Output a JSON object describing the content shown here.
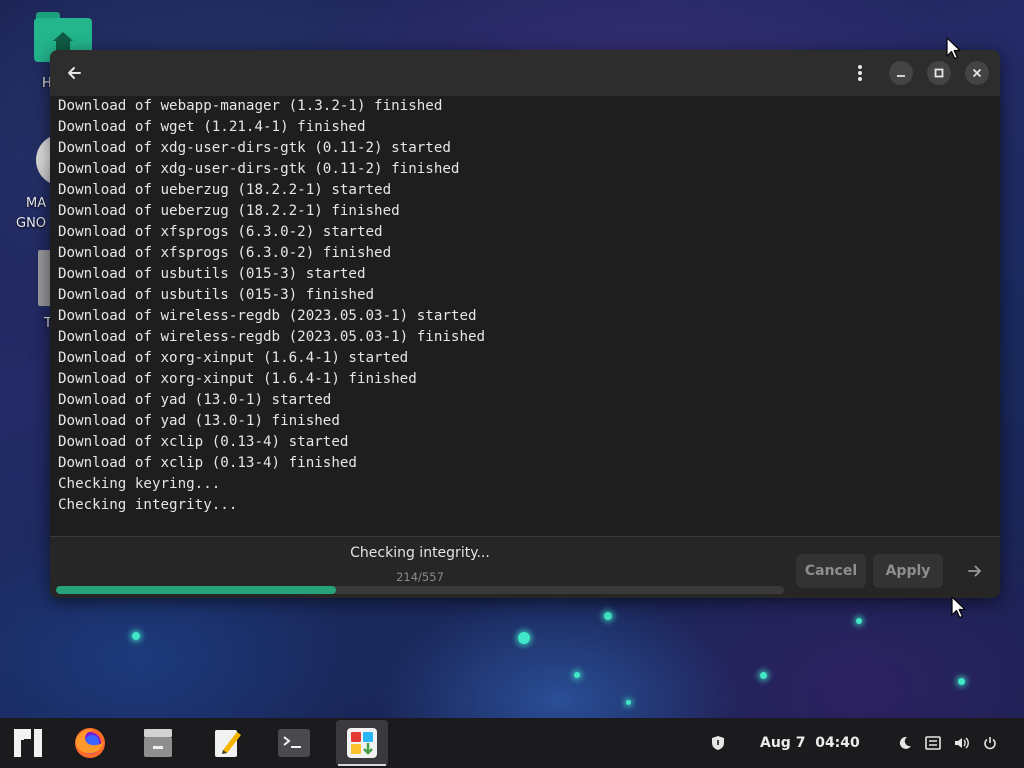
{
  "desktop": {
    "icons": [
      {
        "name": "home",
        "label": "H"
      },
      {
        "name": "manjaro-gnome",
        "label": "MA",
        "label2": "GNO"
      },
      {
        "name": "trash",
        "label": "T"
      }
    ]
  },
  "window": {
    "log_lines": [
      "Download of webapp-manager (1.3.2-1) finished",
      "Download of wget (1.21.4-1) finished",
      "Download of xdg-user-dirs-gtk (0.11-2) started",
      "Download of xdg-user-dirs-gtk (0.11-2) finished",
      "Download of ueberzug (18.2.2-1) started",
      "Download of ueberzug (18.2.2-1) finished",
      "Download of xfsprogs (6.3.0-2) started",
      "Download of xfsprogs (6.3.0-2) finished",
      "Download of usbutils (015-3) started",
      "Download of usbutils (015-3) finished",
      "Download of wireless-regdb (2023.05.03-1) started",
      "Download of wireless-regdb (2023.05.03-1) finished",
      "Download of xorg-xinput (1.6.4-1) started",
      "Download of xorg-xinput (1.6.4-1) finished",
      "Download of yad (13.0-1) started",
      "Download of yad (13.0-1) finished",
      "Download of xclip (0.13-4) started",
      "Download of xclip (0.13-4) finished",
      "Checking keyring...",
      "Checking integrity..."
    ],
    "footer": {
      "status": "Checking integrity...",
      "progress_text": "214/557",
      "progress_fraction": 0.384,
      "cancel_label": "Cancel",
      "apply_label": "Apply"
    },
    "icons": {
      "back": "arrow-left-icon",
      "menu": "kebab-menu-icon",
      "minimize": "minimize-icon",
      "maximize": "maximize-icon",
      "close": "close-icon",
      "next": "arrow-right-icon"
    }
  },
  "taskbar": {
    "apps": [
      "manjaro-menu",
      "firefox",
      "files",
      "text-editor",
      "terminal",
      "software-manager"
    ],
    "active_app": "software-manager",
    "clock": {
      "date": "Aug 7",
      "time": "04:40"
    },
    "tray": [
      "shield-icon",
      "night-mode-icon",
      "network-icon",
      "volume-icon",
      "power-icon"
    ]
  },
  "colors": {
    "accent": "#27a37c",
    "window_bg": "#1e1e1e",
    "headerbar_bg": "#2d2d2d",
    "taskbar_bg": "#1b1b1d"
  }
}
